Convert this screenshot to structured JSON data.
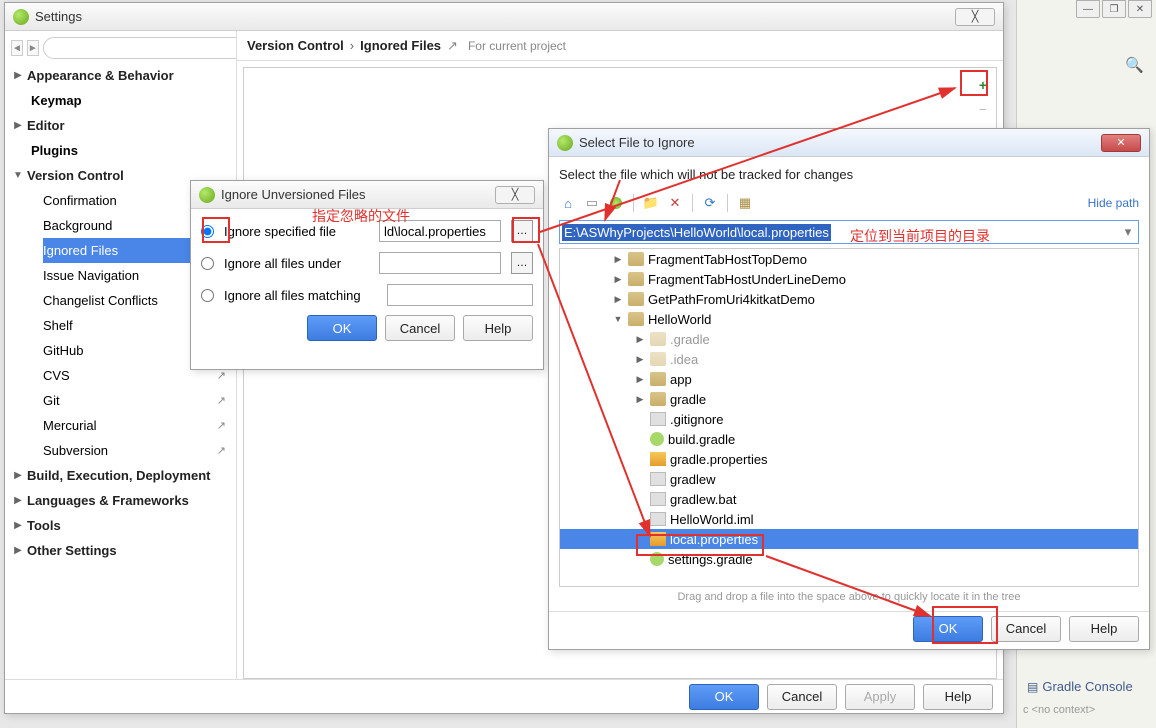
{
  "settings": {
    "title": "Settings",
    "search_placeholder": "",
    "breadcrumb": {
      "a": "Version Control",
      "b": "Ignored Files",
      "note": "For current project"
    },
    "sidebar": {
      "appearance": "Appearance & Behavior",
      "keymap": "Keymap",
      "editor": "Editor",
      "plugins": "Plugins",
      "version_control": "Version Control",
      "vc_children": {
        "confirmation": "Confirmation",
        "background": "Background",
        "ignored": "Ignored Files",
        "issue": "Issue Navigation",
        "changelist": "Changelist Conflicts",
        "shelf": "Shelf",
        "github": "GitHub",
        "cvs": "CVS",
        "git": "Git",
        "mercurial": "Mercurial",
        "subversion": "Subversion"
      },
      "build": "Build, Execution, Deployment",
      "lang": "Languages & Frameworks",
      "tools": "Tools",
      "other": "Other Settings"
    },
    "buttons": {
      "ok": "OK",
      "cancel": "Cancel",
      "apply": "Apply",
      "help": "Help"
    }
  },
  "ignore_dialog": {
    "title": "Ignore Unversioned Files",
    "r1": "Ignore specified file",
    "r2": "Ignore all files under",
    "r3": "Ignore all files matching",
    "value": "ld\\local.properties",
    "ok": "OK",
    "cancel": "Cancel",
    "help": "Help"
  },
  "chooser": {
    "title": "Select File to Ignore",
    "label": "Select the file which will not be tracked for changes",
    "hide_path": "Hide path",
    "path": "E:\\ASWhyProjects\\HelloWorld\\local.properties",
    "tree": {
      "a": "FragmentTabHostTopDemo",
      "b": "FragmentTabHostUnderLineDemo",
      "c": "GetPathFromUri4kitkatDemo",
      "hw": "HelloWorld",
      "gradle_dir": ".gradle",
      "idea": ".idea",
      "app": "app",
      "gradle": "gradle",
      "gitignore": ".gitignore",
      "build_gradle": "build.gradle",
      "gradle_props": "gradle.properties",
      "gradlew": "gradlew",
      "gradlew_bat": "gradlew.bat",
      "iml": "HelloWorld.iml",
      "local": "local.properties",
      "settings_gradle": "settings.gradle"
    },
    "hint": "Drag and drop a file into the space above to quickly locate it in the tree",
    "ok": "OK",
    "cancel": "Cancel",
    "help": "Help"
  },
  "annotations": {
    "a1": "指定忽略的文件",
    "a2": "定位到当前项目的目录"
  },
  "fringe": {
    "console": "Gradle Console",
    "ctx": "c <no context>"
  }
}
